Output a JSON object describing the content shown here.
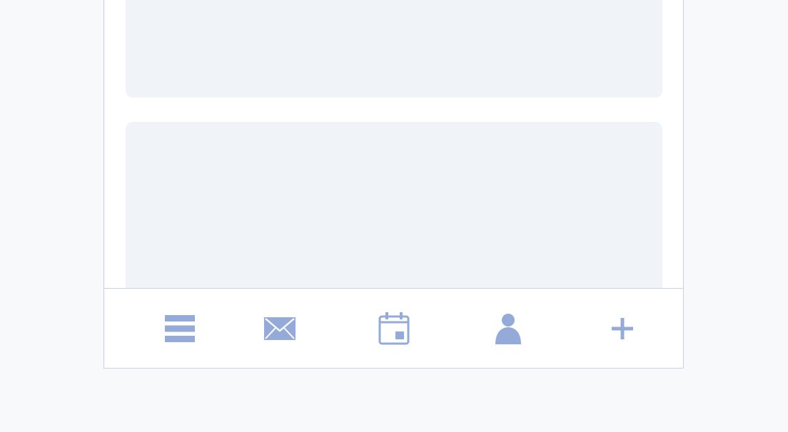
{
  "accent_color": "#94abda",
  "frame_border_color": "#c8d2e6",
  "card_color": "#f0f4f9",
  "content": {
    "cards": [
      {
        "state": "placeholder"
      },
      {
        "state": "placeholder"
      }
    ]
  },
  "tab_bar": {
    "tabs": [
      {
        "icon": "menu-icon"
      },
      {
        "icon": "mail-icon"
      },
      {
        "icon": "calendar-icon"
      },
      {
        "icon": "profile-icon"
      },
      {
        "icon": "plus-icon"
      }
    ]
  }
}
